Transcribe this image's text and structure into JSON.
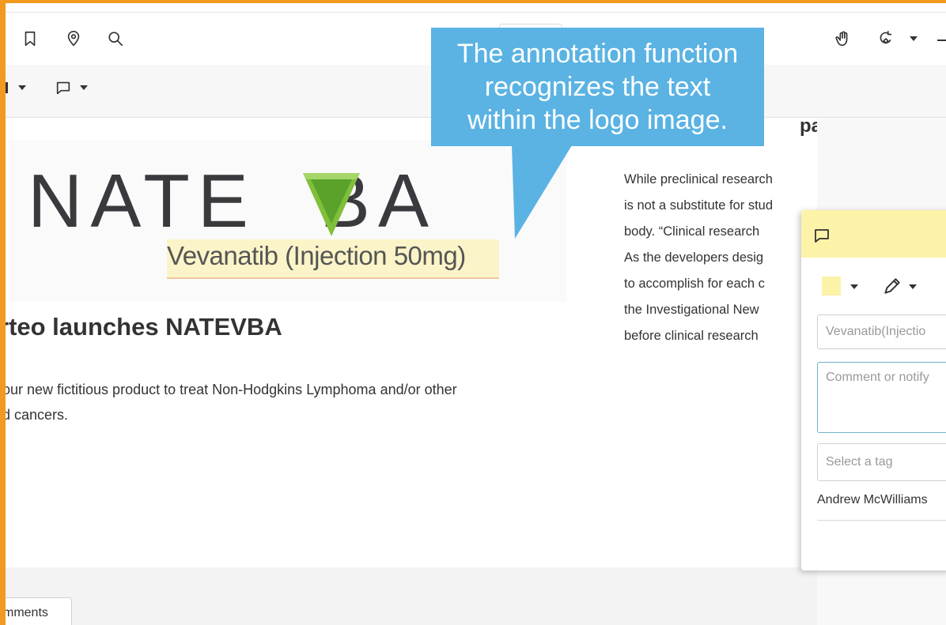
{
  "toolbar": {
    "left_icons": [
      "bookmark-icon",
      "location-pin-icon",
      "search-icon"
    ],
    "right_icons": [
      "hand-tool-icon",
      "rotate-tool-icon"
    ]
  },
  "subbar": {
    "icons": [
      "comment-icon"
    ]
  },
  "document": {
    "logo_text": "NATE",
    "logo_mid": "V",
    "logo_end": "BA",
    "logo_subtitle": "Vevanatib (Injection 50mg)",
    "headline": "rteo launches NATEVBA",
    "body_lines": [
      "our new fictitious product to treat Non-Hodgkins Lymphoma and/or other",
      "d cancers."
    ],
    "right_heading": "pa",
    "right_column_lines": [
      "While preclinical research",
      "is not a substitute for stud",
      "body. “Clinical research",
      "As the developers desig",
      "to accomplish for each c",
      "the Investigational New",
      "before clinical research"
    ]
  },
  "comment_popup": {
    "selected_text": "Vevanatib(Injectio",
    "comment_placeholder": "Comment or notify",
    "tag_placeholder": "Select a tag",
    "author": "Andrew McWilliams",
    "highlight_color": "#fdf3a8"
  },
  "bottom_tab": {
    "label": "mments"
  },
  "callout": {
    "lines": [
      "The annotation function",
      "recognizes the text",
      "within the logo image."
    ],
    "color": "#5ab3e3"
  }
}
